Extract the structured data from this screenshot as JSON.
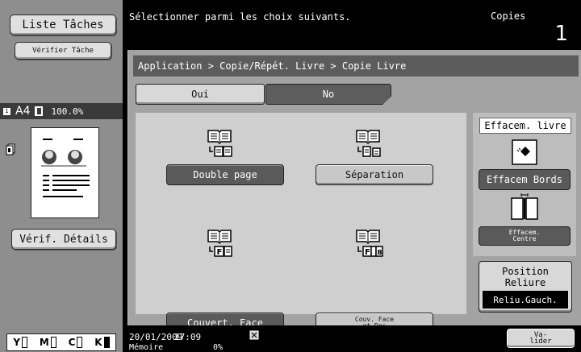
{
  "sidebar": {
    "liste_taches": "Liste Tâches",
    "verifier_tache": "Vérifier Tâche",
    "paper_badge": "1",
    "paper_size": "A4",
    "zoom": "100.0%",
    "verif_details": "Vérif. Détails",
    "toner": [
      {
        "letter": "Y",
        "level": "low"
      },
      {
        "letter": "M",
        "level": "low"
      },
      {
        "letter": "C",
        "level": "low"
      },
      {
        "letter": "K",
        "level": "full"
      }
    ]
  },
  "header": {
    "message": "Sélectionner parmi les choix suivants.",
    "copies_label": "Copies",
    "copies_count": "1"
  },
  "main": {
    "breadcrumb": "Application > Copie/Répét. Livre > Copie Livre",
    "toggle": {
      "oui": "Oui",
      "no": "No",
      "selected": "No"
    },
    "options": [
      {
        "label": "Double page",
        "selected": true
      },
      {
        "label": "Séparation",
        "selected": false
      },
      {
        "label": "Couvert. Face",
        "selected": true
      },
      {
        "label_line1": "Couv. Face",
        "label_line2": "et Dos",
        "selected": false
      }
    ],
    "erase": {
      "title": "Effacem. livre",
      "bords_label": "Effacem Bords",
      "centre_line1": "Effacem.",
      "centre_line2": "Centre"
    },
    "position": {
      "label_line1": "Position",
      "label_line2": "Reliure",
      "value": "Reliu.Gauch."
    }
  },
  "footer": {
    "date": "20/01/2009",
    "time": "17:09",
    "memory_label": "Mémoire",
    "memory_value": "0%",
    "valider_line1": "Va-",
    "valider_line2": "lider"
  },
  "colors": {
    "selected_button": "#5a5a5a",
    "unselected_button": "#c8c8c8",
    "panel_bg": "#cfcfcf",
    "main_bg": "#a3a3a3"
  }
}
